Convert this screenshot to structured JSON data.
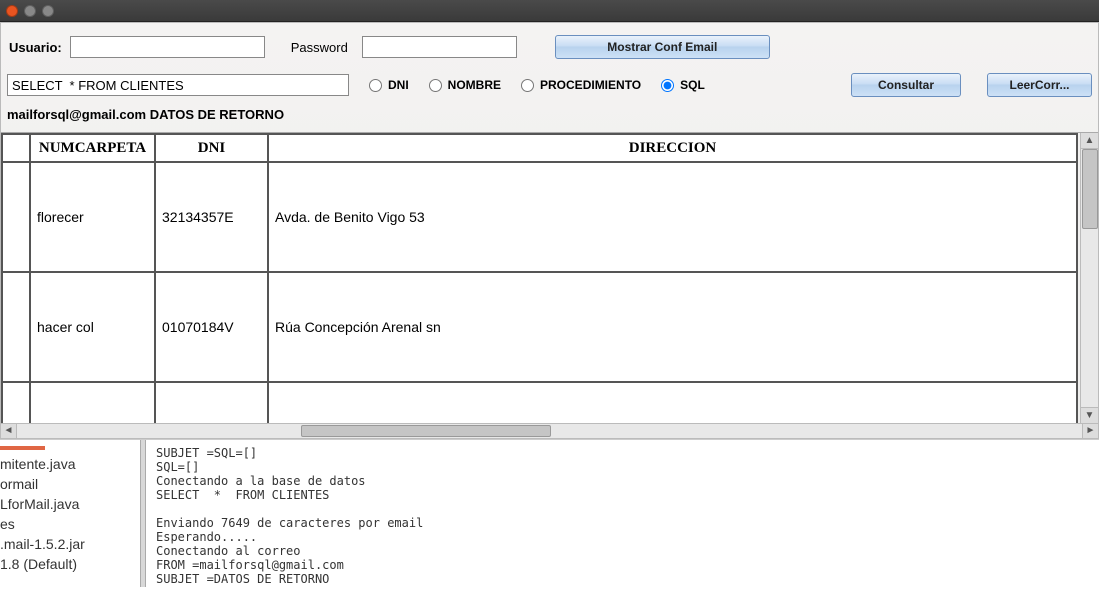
{
  "titlebar": {},
  "row1": {
    "usuario_label": "Usuario:",
    "usuario_value": "",
    "password_label": "Password",
    "password_value": "",
    "mostrar_label": "Mostrar Conf Email"
  },
  "row2": {
    "sql_value": "SELECT  * FROM CLIENTES",
    "radios": {
      "dni": "DNI",
      "nombre": "NOMBRE",
      "procedimiento": "PROCEDIMIENTO",
      "sql": "SQL",
      "selected": "sql"
    },
    "consultar_label": "Consultar",
    "leer_label": "LeerCorr..."
  },
  "status_line": "mailforsql@gmail.com DATOS DE RETORNO",
  "table": {
    "headers": {
      "numcarpeta": "NUMCARPETA",
      "dni": "DNI",
      "direccion": "DIRECCION"
    },
    "rows": [
      {
        "numcarpeta": "florecer",
        "dni": "32134357E",
        "direccion": "Avda. de Benito Vigo 53"
      },
      {
        "numcarpeta": "hacer col",
        "dni": "01070184V",
        "direccion": "Rúa Concepción Arenal sn"
      }
    ]
  },
  "files": {
    "items": [
      "mitente.java",
      "ormail",
      "LforMail.java",
      "es",
      ".mail-1.5.2.jar",
      "1.8 (Default)"
    ]
  },
  "console": "SUBJET =SQL=[]\nSQL=[]\nConectando a la base de datos\nSELECT  *  FROM CLIENTES\n\nEnviando 7649 de caracteres por email\nEsperando.....\nConectando al correo\nFROM =mailforsql@gmail.com\nSUBJET =DATOS DE RETORNO\nEsperando....."
}
